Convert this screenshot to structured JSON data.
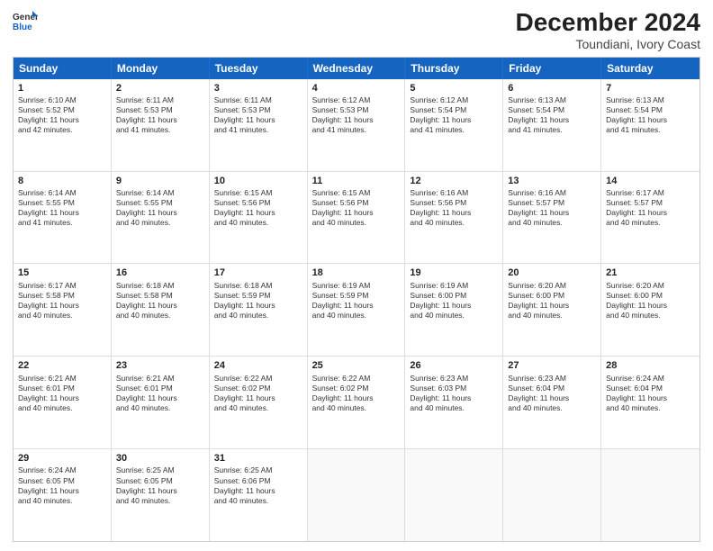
{
  "logo": {
    "line1": "General",
    "line2": "Blue"
  },
  "title": "December 2024",
  "subtitle": "Toundiani, Ivory Coast",
  "weekdays": [
    "Sunday",
    "Monday",
    "Tuesday",
    "Wednesday",
    "Thursday",
    "Friday",
    "Saturday"
  ],
  "weeks": [
    [
      {
        "day": 1,
        "lines": [
          "Sunrise: 6:10 AM",
          "Sunset: 5:52 PM",
          "Daylight: 11 hours",
          "and 42 minutes."
        ]
      },
      {
        "day": 2,
        "lines": [
          "Sunrise: 6:11 AM",
          "Sunset: 5:53 PM",
          "Daylight: 11 hours",
          "and 41 minutes."
        ]
      },
      {
        "day": 3,
        "lines": [
          "Sunrise: 6:11 AM",
          "Sunset: 5:53 PM",
          "Daylight: 11 hours",
          "and 41 minutes."
        ]
      },
      {
        "day": 4,
        "lines": [
          "Sunrise: 6:12 AM",
          "Sunset: 5:53 PM",
          "Daylight: 11 hours",
          "and 41 minutes."
        ]
      },
      {
        "day": 5,
        "lines": [
          "Sunrise: 6:12 AM",
          "Sunset: 5:54 PM",
          "Daylight: 11 hours",
          "and 41 minutes."
        ]
      },
      {
        "day": 6,
        "lines": [
          "Sunrise: 6:13 AM",
          "Sunset: 5:54 PM",
          "Daylight: 11 hours",
          "and 41 minutes."
        ]
      },
      {
        "day": 7,
        "lines": [
          "Sunrise: 6:13 AM",
          "Sunset: 5:54 PM",
          "Daylight: 11 hours",
          "and 41 minutes."
        ]
      }
    ],
    [
      {
        "day": 8,
        "lines": [
          "Sunrise: 6:14 AM",
          "Sunset: 5:55 PM",
          "Daylight: 11 hours",
          "and 41 minutes."
        ]
      },
      {
        "day": 9,
        "lines": [
          "Sunrise: 6:14 AM",
          "Sunset: 5:55 PM",
          "Daylight: 11 hours",
          "and 40 minutes."
        ]
      },
      {
        "day": 10,
        "lines": [
          "Sunrise: 6:15 AM",
          "Sunset: 5:56 PM",
          "Daylight: 11 hours",
          "and 40 minutes."
        ]
      },
      {
        "day": 11,
        "lines": [
          "Sunrise: 6:15 AM",
          "Sunset: 5:56 PM",
          "Daylight: 11 hours",
          "and 40 minutes."
        ]
      },
      {
        "day": 12,
        "lines": [
          "Sunrise: 6:16 AM",
          "Sunset: 5:56 PM",
          "Daylight: 11 hours",
          "and 40 minutes."
        ]
      },
      {
        "day": 13,
        "lines": [
          "Sunrise: 6:16 AM",
          "Sunset: 5:57 PM",
          "Daylight: 11 hours",
          "and 40 minutes."
        ]
      },
      {
        "day": 14,
        "lines": [
          "Sunrise: 6:17 AM",
          "Sunset: 5:57 PM",
          "Daylight: 11 hours",
          "and 40 minutes."
        ]
      }
    ],
    [
      {
        "day": 15,
        "lines": [
          "Sunrise: 6:17 AM",
          "Sunset: 5:58 PM",
          "Daylight: 11 hours",
          "and 40 minutes."
        ]
      },
      {
        "day": 16,
        "lines": [
          "Sunrise: 6:18 AM",
          "Sunset: 5:58 PM",
          "Daylight: 11 hours",
          "and 40 minutes."
        ]
      },
      {
        "day": 17,
        "lines": [
          "Sunrise: 6:18 AM",
          "Sunset: 5:59 PM",
          "Daylight: 11 hours",
          "and 40 minutes."
        ]
      },
      {
        "day": 18,
        "lines": [
          "Sunrise: 6:19 AM",
          "Sunset: 5:59 PM",
          "Daylight: 11 hours",
          "and 40 minutes."
        ]
      },
      {
        "day": 19,
        "lines": [
          "Sunrise: 6:19 AM",
          "Sunset: 6:00 PM",
          "Daylight: 11 hours",
          "and 40 minutes."
        ]
      },
      {
        "day": 20,
        "lines": [
          "Sunrise: 6:20 AM",
          "Sunset: 6:00 PM",
          "Daylight: 11 hours",
          "and 40 minutes."
        ]
      },
      {
        "day": 21,
        "lines": [
          "Sunrise: 6:20 AM",
          "Sunset: 6:00 PM",
          "Daylight: 11 hours",
          "and 40 minutes."
        ]
      }
    ],
    [
      {
        "day": 22,
        "lines": [
          "Sunrise: 6:21 AM",
          "Sunset: 6:01 PM",
          "Daylight: 11 hours",
          "and 40 minutes."
        ]
      },
      {
        "day": 23,
        "lines": [
          "Sunrise: 6:21 AM",
          "Sunset: 6:01 PM",
          "Daylight: 11 hours",
          "and 40 minutes."
        ]
      },
      {
        "day": 24,
        "lines": [
          "Sunrise: 6:22 AM",
          "Sunset: 6:02 PM",
          "Daylight: 11 hours",
          "and 40 minutes."
        ]
      },
      {
        "day": 25,
        "lines": [
          "Sunrise: 6:22 AM",
          "Sunset: 6:02 PM",
          "Daylight: 11 hours",
          "and 40 minutes."
        ]
      },
      {
        "day": 26,
        "lines": [
          "Sunrise: 6:23 AM",
          "Sunset: 6:03 PM",
          "Daylight: 11 hours",
          "and 40 minutes."
        ]
      },
      {
        "day": 27,
        "lines": [
          "Sunrise: 6:23 AM",
          "Sunset: 6:04 PM",
          "Daylight: 11 hours",
          "and 40 minutes."
        ]
      },
      {
        "day": 28,
        "lines": [
          "Sunrise: 6:24 AM",
          "Sunset: 6:04 PM",
          "Daylight: 11 hours",
          "and 40 minutes."
        ]
      }
    ],
    [
      {
        "day": 29,
        "lines": [
          "Sunrise: 6:24 AM",
          "Sunset: 6:05 PM",
          "Daylight: 11 hours",
          "and 40 minutes."
        ]
      },
      {
        "day": 30,
        "lines": [
          "Sunrise: 6:25 AM",
          "Sunset: 6:05 PM",
          "Daylight: 11 hours",
          "and 40 minutes."
        ]
      },
      {
        "day": 31,
        "lines": [
          "Sunrise: 6:25 AM",
          "Sunset: 6:06 PM",
          "Daylight: 11 hours",
          "and 40 minutes."
        ]
      },
      null,
      null,
      null,
      null
    ]
  ]
}
